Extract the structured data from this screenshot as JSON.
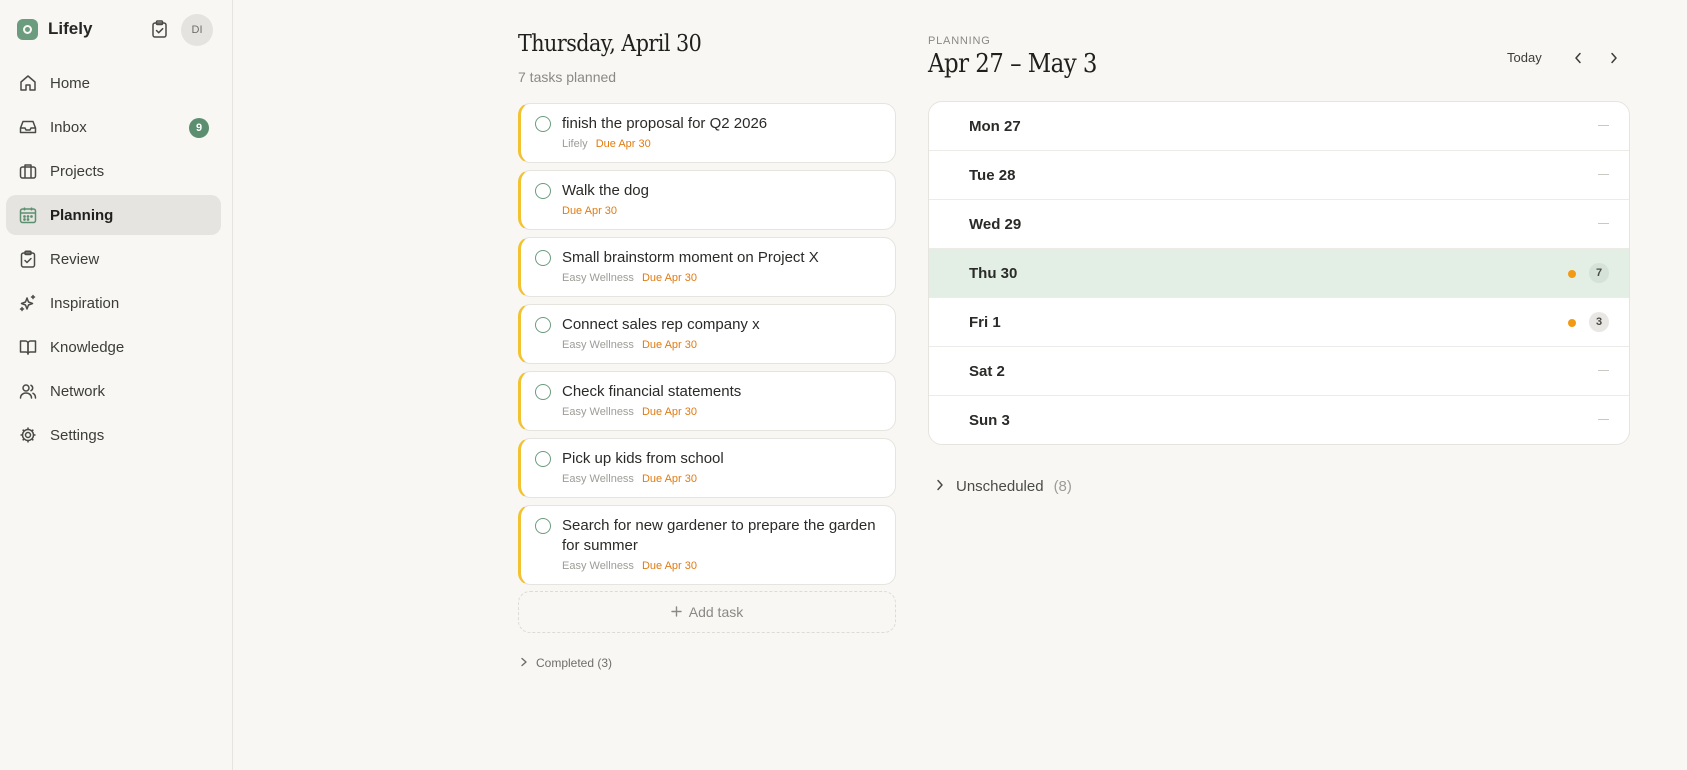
{
  "app": {
    "name": "Lifely",
    "avatar_initials": "DI"
  },
  "sidebar": {
    "items": [
      {
        "label": "Home",
        "icon": "home-icon"
      },
      {
        "label": "Inbox",
        "icon": "inbox-icon",
        "badge": "9"
      },
      {
        "label": "Projects",
        "icon": "briefcase-icon"
      },
      {
        "label": "Planning",
        "icon": "calendar-icon",
        "active": true
      },
      {
        "label": "Review",
        "icon": "clipboard-check-icon"
      },
      {
        "label": "Inspiration",
        "icon": "sparkles-icon"
      },
      {
        "label": "Knowledge",
        "icon": "book-icon"
      },
      {
        "label": "Network",
        "icon": "users-icon"
      },
      {
        "label": "Settings",
        "icon": "gear-icon"
      }
    ]
  },
  "day": {
    "title": "Thursday, April 30",
    "subtitle": "7 tasks planned",
    "tasks": [
      {
        "title": "finish the proposal for Q2 2026",
        "project": "Lifely",
        "due": "Due Apr 30"
      },
      {
        "title": "Walk the dog",
        "project": "",
        "due": "Due Apr 30"
      },
      {
        "title": "Small brainstorm moment on Project X",
        "project": "Easy Wellness",
        "due": "Due Apr 30"
      },
      {
        "title": "Connect sales rep company x",
        "project": "Easy Wellness",
        "due": "Due Apr 30"
      },
      {
        "title": "Check financial statements",
        "project": "Easy Wellness",
        "due": "Due Apr 30"
      },
      {
        "title": "Pick up kids from school",
        "project": "Easy Wellness",
        "due": "Due Apr 30"
      },
      {
        "title": "Search for new gardener to prepare the garden for summer",
        "project": "Easy Wellness",
        "due": "Due Apr 30"
      }
    ],
    "add_task_label": "Add task",
    "completed_label": "Completed (3)"
  },
  "planning": {
    "label": "PLANNING",
    "title": "Apr 27 – May 3",
    "today_label": "Today",
    "days": [
      {
        "label": "Mon 27",
        "count": null
      },
      {
        "label": "Tue 28",
        "count": null
      },
      {
        "label": "Wed 29",
        "count": null
      },
      {
        "label": "Thu 30",
        "count": "7",
        "today": true
      },
      {
        "label": "Fri 1",
        "count": "3"
      },
      {
        "label": "Sat 2",
        "count": null
      },
      {
        "label": "Sun 3",
        "count": null
      }
    ],
    "unscheduled_label": "Unscheduled",
    "unscheduled_count": "(8)"
  },
  "colors": {
    "accent": "#6b9c7e",
    "task_border": "#f2c230",
    "due": "#e07b12",
    "today_row": "#e3efe5"
  }
}
